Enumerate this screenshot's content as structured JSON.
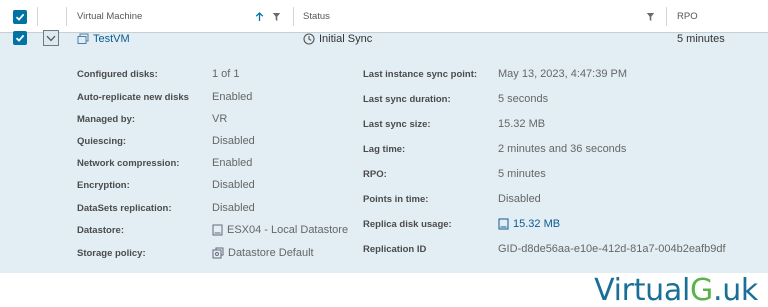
{
  "header": {
    "col_vm": "Virtual Machine",
    "col_status": "Status",
    "col_rpo": "RPO"
  },
  "row": {
    "vm_name": "TestVM",
    "status": "Initial Sync",
    "rpo": "5 minutes"
  },
  "details_left": [
    {
      "label": "Configured disks:",
      "value": "1 of 1"
    },
    {
      "label": "Auto-replicate new disks",
      "value": "Enabled"
    },
    {
      "label": "Managed by:",
      "value": "VR"
    },
    {
      "label": "Quiescing:",
      "value": "Disabled"
    },
    {
      "label": "Network compression:",
      "value": "Enabled"
    },
    {
      "label": "Encryption:",
      "value": "Disabled"
    },
    {
      "label": "DataSets replication:",
      "value": "Disabled"
    },
    {
      "label": "Datastore:",
      "value": "ESX04 - Local Datastore"
    },
    {
      "label": "Storage policy:",
      "value": "Datastore Default"
    }
  ],
  "details_right": [
    {
      "label": "Last instance sync point:",
      "value": "May 13, 2023, 4:47:39 PM"
    },
    {
      "label": "Last sync duration:",
      "value": "5 seconds"
    },
    {
      "label": "Last sync size:",
      "value": "15.32 MB"
    },
    {
      "label": "Lag time:",
      "value": "2 minutes and 36 seconds"
    },
    {
      "label": "RPO:",
      "value": "5 minutes"
    },
    {
      "label": "Points in time:",
      "value": "Disabled"
    },
    {
      "label": "Replica disk usage:",
      "value": "15.32 MB"
    },
    {
      "label": "Replication ID",
      "value": "GID-d8de56aa-e10e-412d-81a7-004b2eafb9df"
    }
  ],
  "logo": {
    "part1": "Virtual",
    "part2": "G",
    "part3": ".uk"
  },
  "colors": {
    "accent": "#0072a3",
    "row_bg": "#e3eef4",
    "link": "#0b5c8f",
    "logo_blue": "#1a6f96",
    "logo_green": "#59b34a"
  },
  "icons": [
    "checkbox-checked-icon",
    "sort-arrow-up-icon",
    "filter-icon",
    "chevron-down-icon",
    "vm-icon",
    "clock-icon",
    "datastore-icon",
    "storage-policy-icon"
  ]
}
